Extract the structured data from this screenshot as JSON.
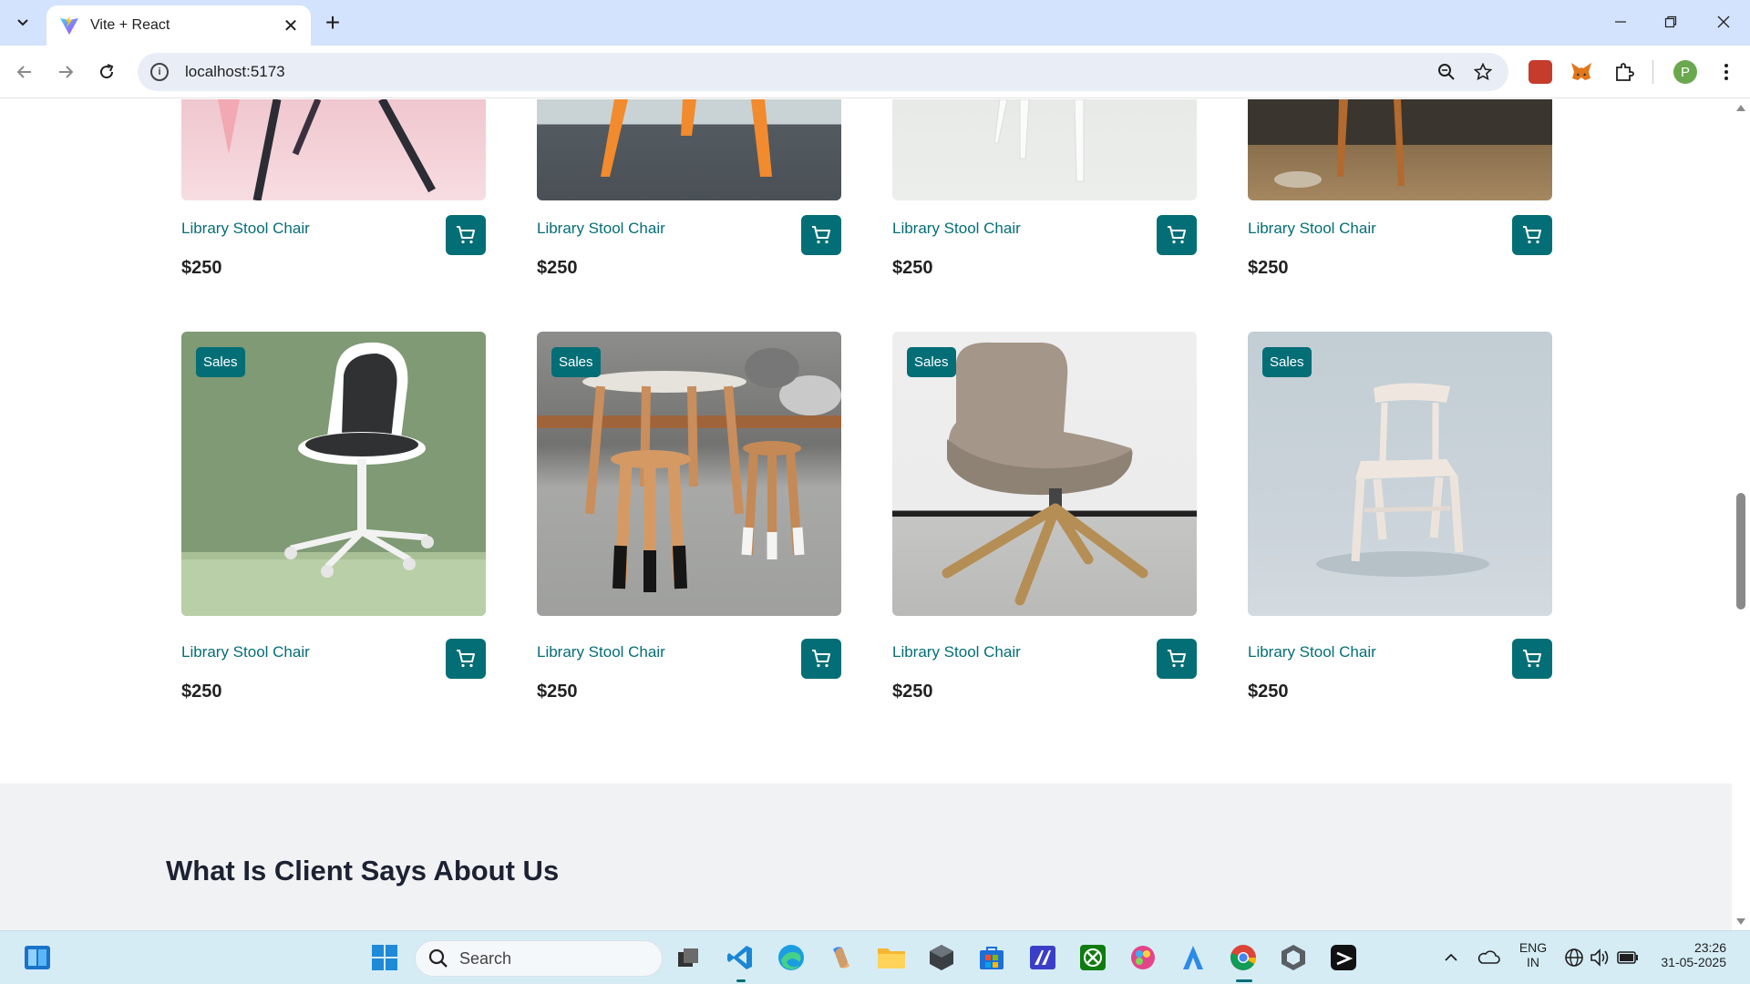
{
  "browser": {
    "tab_title": "Vite + React",
    "url": "localhost:5173",
    "profile_initial": "P"
  },
  "products_row_top": [
    {
      "name": "Library Stool Chair",
      "price": "$250"
    },
    {
      "name": "Library Stool Chair",
      "price": "$250"
    },
    {
      "name": "Library Stool Chair",
      "price": "$250"
    },
    {
      "name": "Library Stool Chair",
      "price": "$250"
    }
  ],
  "products_row_bottom": [
    {
      "badge": "Sales",
      "name": "Library Stool Chair",
      "price": "$250"
    },
    {
      "badge": "Sales",
      "name": "Library Stool Chair",
      "price": "$250"
    },
    {
      "badge": "Sales",
      "name": "Library Stool Chair",
      "price": "$250"
    },
    {
      "badge": "Sales",
      "name": "Library Stool Chair",
      "price": "$250"
    }
  ],
  "testimonials": {
    "heading": "What Is Client Says About Us"
  },
  "taskbar": {
    "search_placeholder": "Search",
    "language_line1": "ENG",
    "language_line2": "IN",
    "time": "23:26",
    "date": "31-05-2025"
  },
  "colors": {
    "brand": "#046e76",
    "heading": "#1d2233",
    "tabbar": "#d3e3fd"
  }
}
